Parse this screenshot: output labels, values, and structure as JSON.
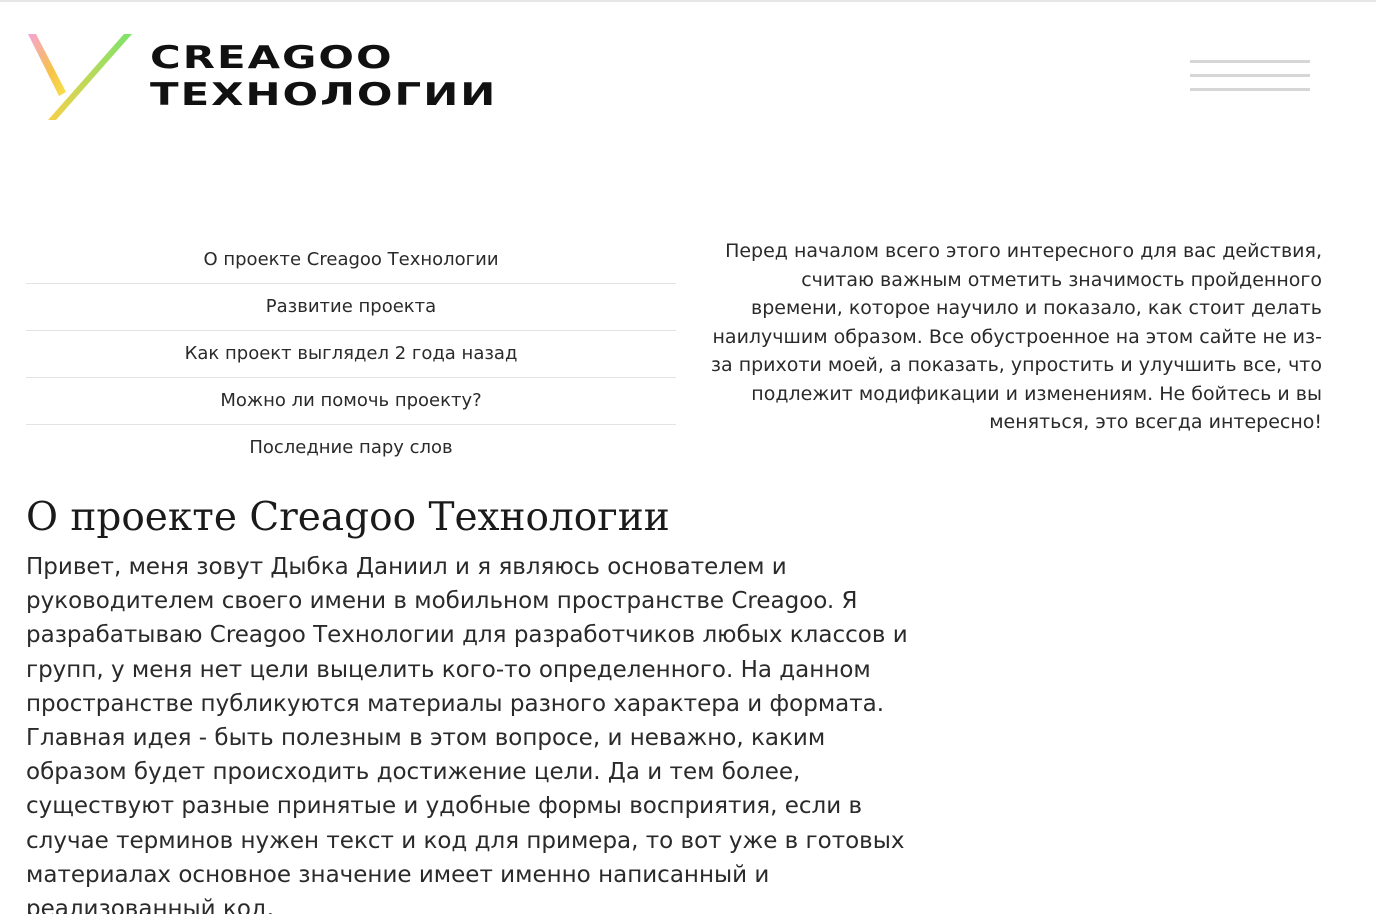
{
  "header": {
    "logo_line1": "CREAGOO",
    "logo_line2": "ТЕХНОЛОГИИ",
    "logo_icon": "gradient-y-icon",
    "menu_icon": "hamburger-icon"
  },
  "toc": {
    "items": [
      "О проекте Creagoo Технологии",
      "Развитие проекта",
      "Как проект выглядел 2 года назад",
      "Можно ли помочь проекту?",
      "Последние пару слов"
    ]
  },
  "intro": {
    "text": "Перед началом всего этого интересного для вас действия, считаю важным отметить значимость пройденного времени, которое научило и показало, как стоит делать наилучшим образом. Все обустроенное на этом сайте не из-за прихоти моей, а показать, упростить и улучшить все, что подлежит модификации и изменениям. Не бойтесь и вы меняться, это всегда интересно!"
  },
  "section": {
    "title": "О проекте Creagoo Технологии",
    "body": "Привет, меня зовут Дыбка Даниил и я являюсь основателем и руководителем своего имени в мобильном пространстве Creagoo. Я разрабатываю Creagoo Технологии для разработчиков любых классов и групп, у меня нет цели выцелить кого-то определенного. На данном пространстве публикуются материалы разного характера и формата. Главная идея - быть полезным в этом вопросе, и неважно, каким образом будет происходить достижение цели. Да и тем более, существуют разные принятые и удобные формы восприятия, если в случае терминов нужен текст и код для примера, то вот уже в готовых материалах основное значение имеет именно написанный и реализованный код."
  },
  "colors": {
    "logo_gradient_start": "#f5a3d8",
    "logo_gradient_mid": "#f7d04a",
    "logo_gradient_end": "#7be36a",
    "divider": "#e3e3e3",
    "menu_bars": "#d6d6d6",
    "text": "#2a2a2a"
  }
}
